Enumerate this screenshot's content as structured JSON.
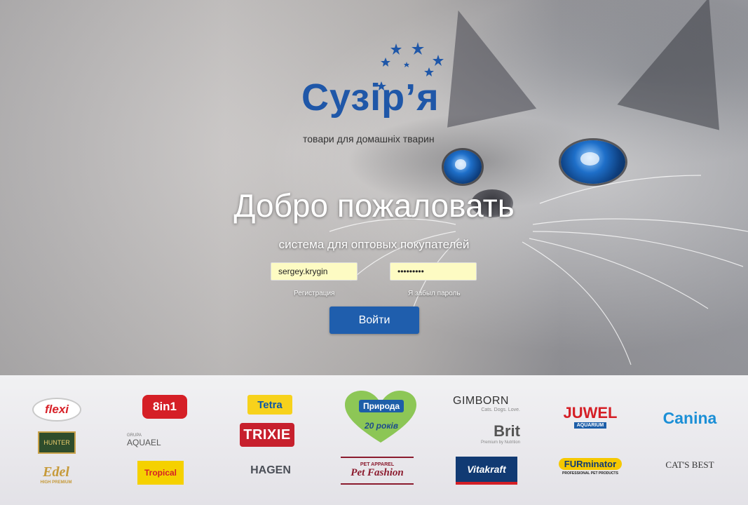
{
  "logo": {
    "name": "Сузір’я",
    "tagline": "товари для домашніх тварин",
    "icon": "stars-icon"
  },
  "welcome": {
    "title": "Добро пожаловать",
    "subtitle": "система для оптовых покупателей"
  },
  "login_form": {
    "username_value": "sergey.krygin",
    "password_value": "•••••••••",
    "register_link": "Регистрация",
    "forgot_link": "Я забыл пароль",
    "submit_label": "Войти"
  },
  "brands": [
    {
      "name": "flexi"
    },
    {
      "name": "8in1"
    },
    {
      "name": "Tetra"
    },
    {
      "name": "Природа",
      "subtext": "20 років"
    },
    {
      "name": "GIMBORN",
      "subtext": "Cats. Dogs. Love."
    },
    {
      "name": "JUWEL",
      "subtext": "AQUARIUM"
    },
    {
      "name": "Canina"
    },
    {
      "name": "HUNTER"
    },
    {
      "name": "AQUAEL",
      "subtext": "GRUPA"
    },
    {
      "name": "TRIXIE"
    },
    {
      "name": "Brit",
      "subtext": "Premium by Nutrition"
    },
    {
      "name": "Edel",
      "subtext": "HIGH PREMIUM"
    },
    {
      "name": "Tropical"
    },
    {
      "name": "HAGEN"
    },
    {
      "name": "Pet Fashion",
      "subtext": "PET APPAREL"
    },
    {
      "name": "Vitakraft"
    },
    {
      "name": "FURminator",
      "subtext": "PROFESSIONAL PET PRODUCTS"
    },
    {
      "name": "CAT'S BEST"
    }
  ],
  "colors": {
    "brand_blue": "#1f5ead",
    "logo_blue": "#1f57a8",
    "input_bg": "#fdfbc3"
  }
}
